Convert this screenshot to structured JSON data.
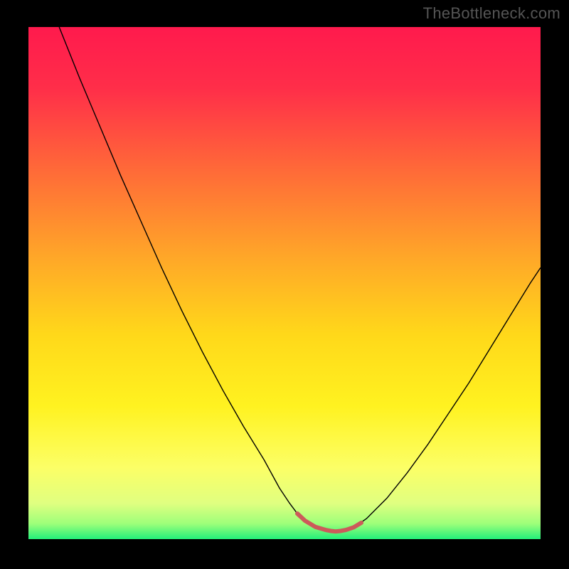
{
  "watermark": "TheBottleneck.com",
  "chart_data": {
    "type": "line",
    "title": "",
    "xlabel": "",
    "ylabel": "",
    "xlim": [
      0,
      100
    ],
    "ylim": [
      0,
      100
    ],
    "legend": [],
    "grid": false,
    "background_gradient": {
      "stops": [
        {
          "offset": 0.0,
          "color": "#ff1a4d"
        },
        {
          "offset": 0.12,
          "color": "#ff2e49"
        },
        {
          "offset": 0.28,
          "color": "#ff6a38"
        },
        {
          "offset": 0.45,
          "color": "#ffa728"
        },
        {
          "offset": 0.6,
          "color": "#ffd81a"
        },
        {
          "offset": 0.74,
          "color": "#fff220"
        },
        {
          "offset": 0.86,
          "color": "#fcff66"
        },
        {
          "offset": 0.93,
          "color": "#e0ff80"
        },
        {
          "offset": 0.97,
          "color": "#9dff7a"
        },
        {
          "offset": 1.0,
          "color": "#23f07a"
        }
      ]
    },
    "series": [
      {
        "name": "bottleneck-curve",
        "color": "#000000",
        "stroke_width": 1.4,
        "x": [
          6,
          10,
          14,
          18,
          22,
          26,
          30,
          34,
          38,
          42,
          46,
          49,
          51,
          52.5,
          54,
          56,
          58,
          59,
          60,
          61,
          62,
          64,
          66,
          70,
          74,
          78,
          82,
          86,
          90,
          94,
          98,
          100
        ],
        "y": [
          100,
          90,
          80.5,
          71,
          62,
          53,
          44.5,
          36.5,
          29,
          22,
          15.5,
          10,
          7,
          5,
          3.6,
          2.4,
          1.8,
          1.6,
          1.5,
          1.6,
          1.8,
          2.6,
          4,
          8,
          13,
          18.5,
          24.5,
          30.5,
          37,
          43.5,
          50,
          53
        ]
      },
      {
        "name": "flat-minimum-highlight",
        "color": "#cc5a5a",
        "stroke_width": 6,
        "x": [
          52.5,
          54,
          56,
          58,
          59,
          60,
          61,
          62,
          63.5,
          65
        ],
        "y": [
          5.0,
          3.6,
          2.4,
          1.8,
          1.6,
          1.5,
          1.6,
          1.8,
          2.3,
          3.2
        ]
      }
    ]
  }
}
